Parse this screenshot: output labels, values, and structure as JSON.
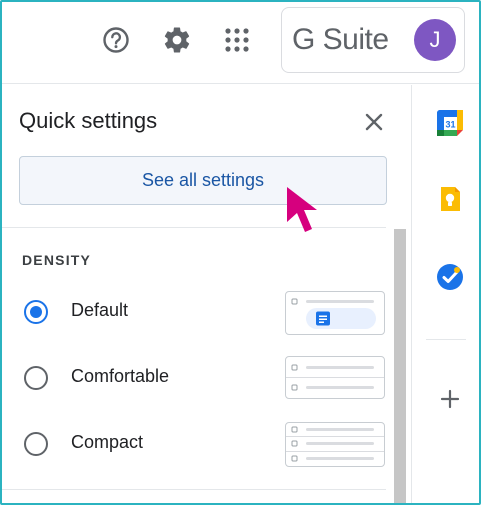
{
  "header": {
    "help_icon": "help-circle-icon",
    "settings_icon": "gear-icon",
    "apps_icon": "apps-grid-icon",
    "brand": "G Suite",
    "avatar_initial": "J",
    "avatar_color": "#7e57c2"
  },
  "quick_settings": {
    "title": "Quick settings",
    "close_icon": "close-icon",
    "see_all_label": "See all settings",
    "density": {
      "heading": "DENSITY",
      "options": [
        {
          "label": "Default",
          "selected": true
        },
        {
          "label": "Comfortable",
          "selected": false
        },
        {
          "label": "Compact",
          "selected": false
        }
      ]
    }
  },
  "side_rail": {
    "items": [
      "calendar-icon",
      "keep-icon",
      "tasks-icon"
    ],
    "calendar_day": "31",
    "add_icon": "plus-icon"
  },
  "colors": {
    "accent": "#1a73e8",
    "frame": "#2bb3c0",
    "cursor": "#d6007e"
  }
}
